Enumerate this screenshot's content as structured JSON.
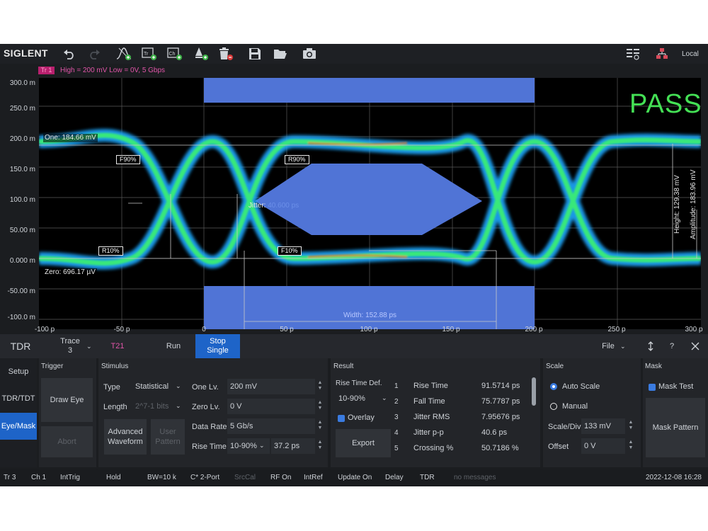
{
  "toolbar": {
    "brand": "SIGLENT",
    "local_label": "Local",
    "icons": [
      "undo-icon",
      "redo-icon",
      "add-eye-icon",
      "add-trace-icon",
      "add-channel-icon",
      "add-marker-icon",
      "delete-icon",
      "save-icon",
      "open-folder-icon",
      "camera-icon",
      "layout-icon",
      "network-icon"
    ]
  },
  "plot": {
    "trace_tag": "Tr 1",
    "trace_info": "High = 200 mV  Low = 0V,  5 Gbps",
    "y_ticks": [
      "300.0 m",
      "250.0 m",
      "200.0 m",
      "150.0 m",
      "100.0 m",
      "50.00 m",
      "0.000 m",
      "-50.00 m",
      "-100.0 m"
    ],
    "x_ticks": [
      "-100 p",
      "-50 p",
      "0",
      "50 p",
      "100 p",
      "150 p",
      "200 p",
      "250 p",
      "300 p"
    ],
    "pass_text": "PASS",
    "one_label": "One: 184.66 mV",
    "zero_label": "Zero: 696.17 µV",
    "f90": "F90%",
    "r90": "R90%",
    "r10": "R10%",
    "f10": "F10%",
    "jitter_label": "Jitter:",
    "jitter_value": "40.600 ps",
    "width_label": "Width: 152.88 ps",
    "height_label": "Height: 129.38 mV",
    "amplitude_label": "Amplitude: 183.96 mV",
    "colors": {
      "eye_cool": "#1fa8ff",
      "eye_hot": "#39e87a",
      "mask": "#5074d6",
      "pass": "#44e055"
    }
  },
  "panel": {
    "title": "TDR",
    "trace_label": "Trace",
    "trace_value": "3",
    "t21": "T21",
    "run": "Run",
    "stop": "Stop",
    "single": "Single",
    "file": "File",
    "help": "?",
    "nav": [
      "Setup",
      "TDR/TDT",
      "Eye/Mask"
    ],
    "trigger": {
      "title": "Trigger",
      "draw_eye": "Draw Eye",
      "abort": "Abort"
    },
    "stimulus": {
      "title": "Stimulus",
      "type_label": "Type",
      "type_value": "Statistical",
      "length_label": "Length",
      "length_value": "2^7-1 bits",
      "advanced_waveform": "Advanced Waveform",
      "user_pattern": "User Pattern",
      "one_lv_label": "One Lv.",
      "one_lv_value": "200 mV",
      "zero_lv_label": "Zero Lv.",
      "zero_lv_value": "0 V",
      "data_rate_label": "Data Rate",
      "data_rate_value": "5 Gb/s",
      "rise_time_label": "Rise Time",
      "rise_time_def": "10-90%",
      "rise_time_value": "37.2 ps"
    },
    "result": {
      "title": "Result",
      "rise_time_def_label": "Rise Time Def.",
      "rise_time_def_value": "10-90%",
      "overlay": "Overlay",
      "export": "Export",
      "rows": [
        {
          "idx": "1",
          "name": "Rise Time",
          "value": "91.5714 ps"
        },
        {
          "idx": "2",
          "name": "Fall Time",
          "value": "75.7787 ps"
        },
        {
          "idx": "3",
          "name": "Jitter RMS",
          "value": "7.95676 ps"
        },
        {
          "idx": "4",
          "name": "Jitter p-p",
          "value": "40.6 ps"
        },
        {
          "idx": "5",
          "name": "Crossing %",
          "value": "50.7186 %"
        }
      ]
    },
    "scale": {
      "title": "Scale",
      "auto": "Auto Scale",
      "manual": "Manual",
      "div_label": "Scale/Div",
      "div_value": "133 mV",
      "offset_label": "Offset",
      "offset_value": "0 V"
    },
    "mask": {
      "title": "Mask",
      "mask_test": "Mask Test",
      "mask_pattern": "Mask Pattern"
    }
  },
  "status": {
    "items": [
      "Tr 3",
      "Ch 1",
      "IntTrig",
      "Hold",
      "BW=10 k",
      "C* 2-Port",
      "SrcCal",
      "RF On",
      "IntRef",
      "Update On",
      "Delay",
      "TDR"
    ],
    "message": "no messages",
    "datetime": "2022-12-08 16:28"
  }
}
